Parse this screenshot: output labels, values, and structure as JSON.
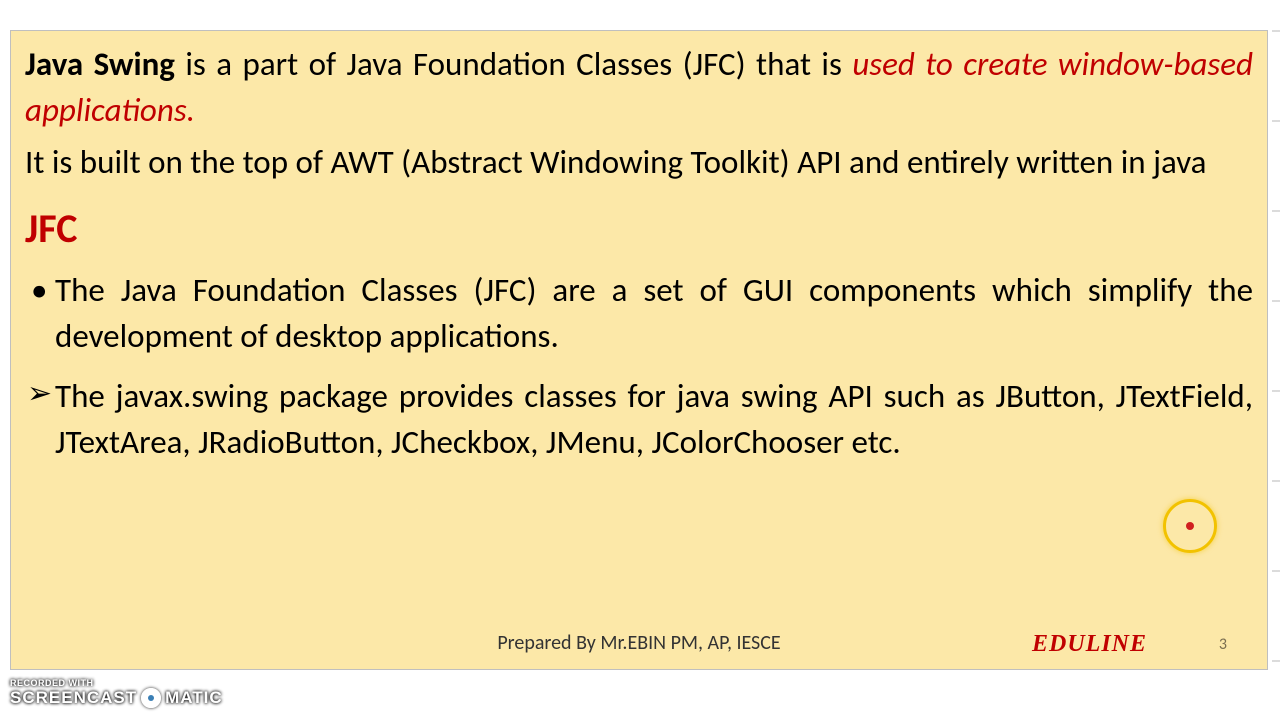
{
  "para1": {
    "bold": "Java Swing",
    "mid": " is a part of Java Foundation Classes (JFC) that is ",
    "red": "used to create window-based applications",
    "dot": "."
  },
  "para2": "It is built on the top of AWT (Abstract Windowing Toolkit) API and entirely written in java",
  "heading": "JFC",
  "bullet1": "The Java Foundation Classes (JFC) are a set of GUI components which simplify the development of desktop applications.",
  "arrow1": "The javax.swing package provides classes for java swing API such as JButton, JTextField, JTextArea, JRadioButton, JCheckbox, JMenu, JColorChooser etc.",
  "footer": {
    "center": "Prepared By Mr.EBIN PM, AP, IESCE",
    "brand": "EDULINE",
    "page": "3"
  },
  "watermark": {
    "line1": "RECORDED WITH",
    "brand_a": "SCREENCAST",
    "brand_b": "MATIC"
  }
}
